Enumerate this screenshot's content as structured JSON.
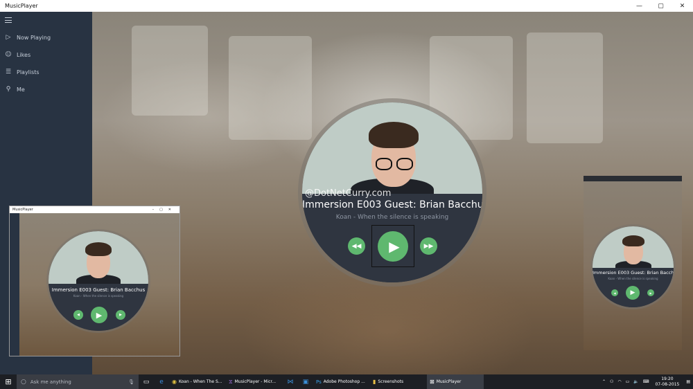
{
  "window": {
    "title": "MusicPlayer",
    "controls": {
      "minimize": "—",
      "maximize": "▢",
      "close": "✕"
    }
  },
  "sidebar": {
    "items": [
      {
        "icon": "▷",
        "label": "Now Playing"
      },
      {
        "icon": "☺",
        "label": "Likes"
      },
      {
        "icon": "☰",
        "label": "Playlists"
      },
      {
        "icon": "⚲",
        "label": "Me"
      }
    ]
  },
  "player": {
    "title": "Immersion E003 Guest: Brian Bacchus",
    "subtitle": "Koan - When the silence is speaking",
    "watermark": "@DotNetCurry.com"
  },
  "mini_window": {
    "title": "MusicPlayer"
  },
  "taskbar": {
    "search_placeholder": "Ask me anything",
    "apps": [
      {
        "icon": "chrome-icon",
        "label": "Koan - When The S..."
      },
      {
        "icon": "visual-studio-icon",
        "label": "MusicPlayer - Micr..."
      },
      {
        "icon": "vscode-icon",
        "label": ""
      },
      {
        "icon": "store-icon",
        "label": ""
      },
      {
        "icon": "photoshop-icon",
        "label": "Adobe Photoshop ..."
      },
      {
        "icon": "folder-icon",
        "label": "Screenshots"
      },
      {
        "icon": "musicplayer-icon",
        "label": "MusicPlayer"
      }
    ],
    "time": "19:20",
    "date": "07-08-2015"
  },
  "colors": {
    "sidebar": "#283342",
    "accent": "#5fb86f",
    "info_panel": "#2f3540",
    "taskbar": "#1d1f24"
  }
}
